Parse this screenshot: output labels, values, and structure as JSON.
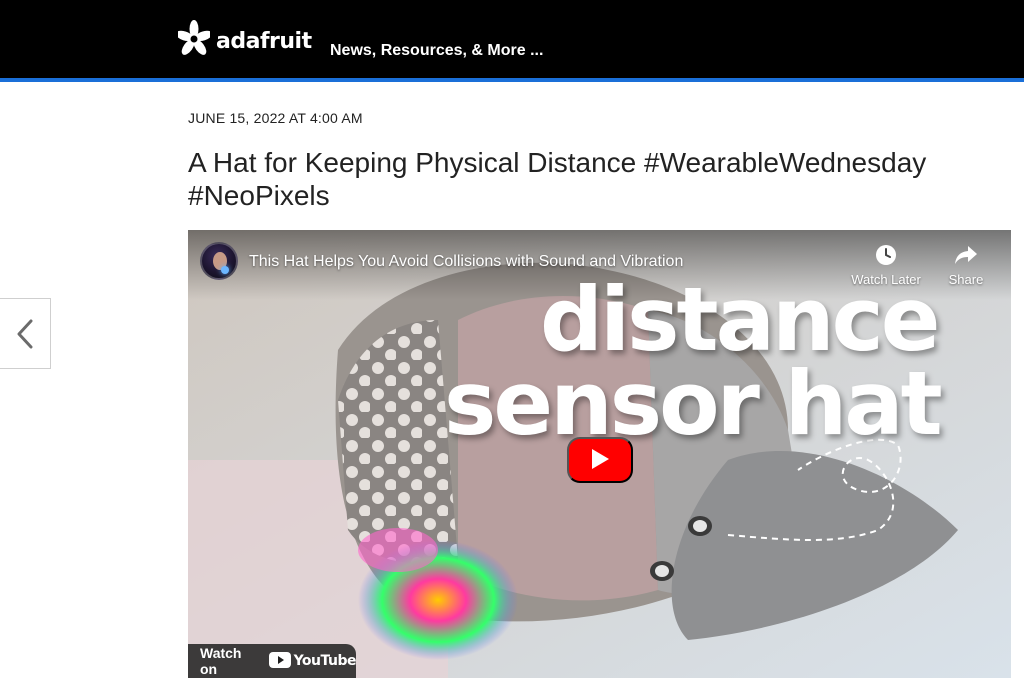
{
  "header": {
    "logo_text": "adafruit",
    "nav_link": "News, Resources, & More ..."
  },
  "post": {
    "date": "JUNE 15, 2022 AT 4:00 AM",
    "title": "A Hat for Keeping Physical Distance #WearableWednesday #NeoPixels"
  },
  "video": {
    "title": "This Hat Helps You Avoid Collisions with Sound and Vibration",
    "watch_later_label": "Watch Later",
    "share_label": "Share",
    "overlay_line1": "distance",
    "overlay_line2": "sensor hat",
    "watch_on_label": "Watch on",
    "youtube_label": "YouTube"
  },
  "colors": {
    "accent": "#1a6fd8",
    "header_bg": "#000000",
    "play_red": "#ff0000"
  },
  "icons": {
    "logo": "adafruit-flower-icon",
    "prev": "chevron-left-icon",
    "watch_later": "clock-icon",
    "share": "share-arrow-icon",
    "play": "play-icon"
  }
}
